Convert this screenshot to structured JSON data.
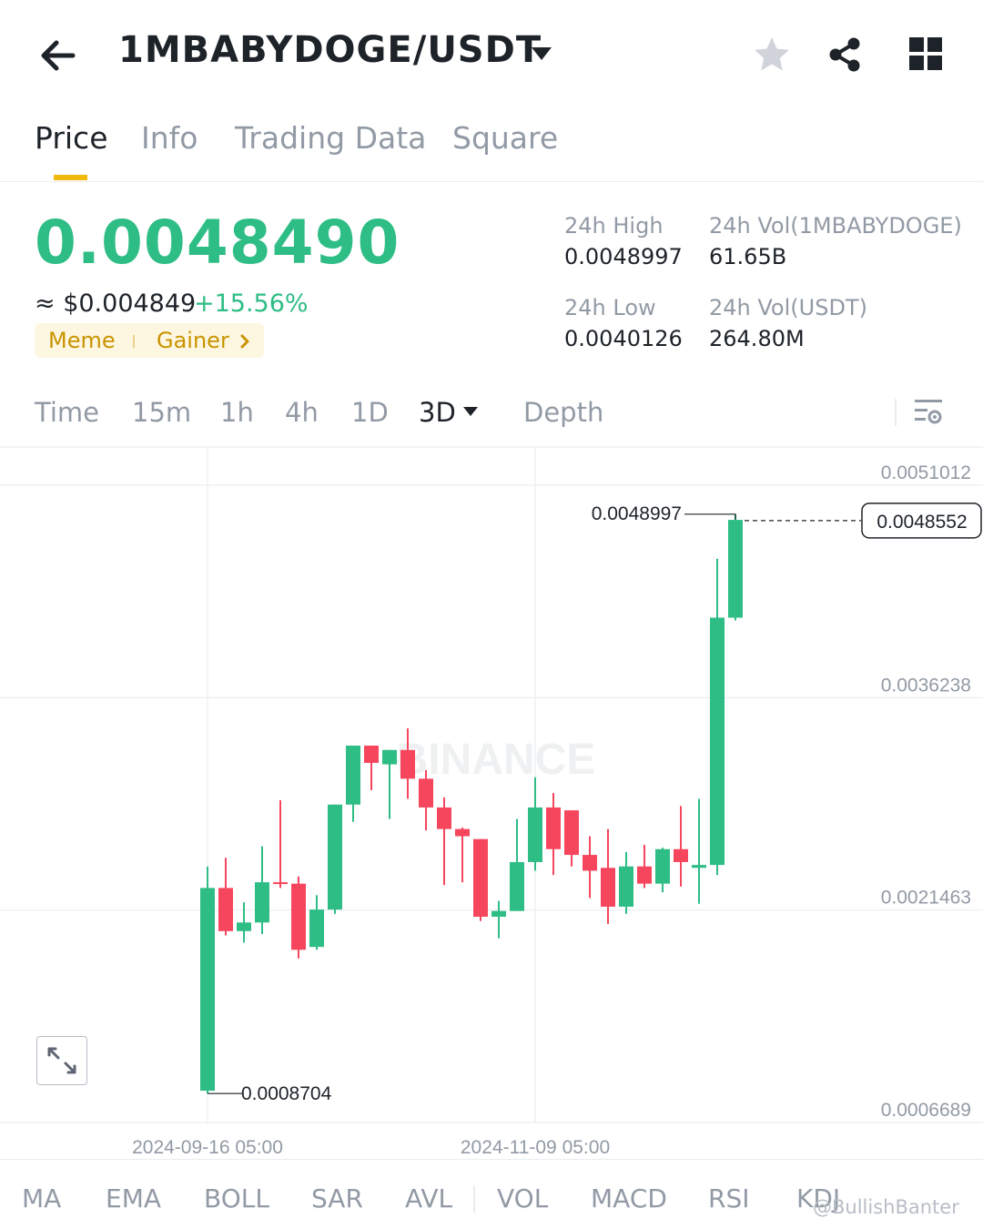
{
  "header": {
    "pair": "1MBABYDOGE/USDT",
    "icons": [
      "back-arrow-icon",
      "caret-down-icon",
      "star-icon",
      "share-icon",
      "grid-icon"
    ]
  },
  "tabs": [
    "Price",
    "Info",
    "Trading Data",
    "Square"
  ],
  "active_tab": "Price",
  "price": {
    "last": "0.0048490",
    "usd": "≈ $0.004849",
    "change": "+15.56%",
    "tags": [
      "Meme",
      "Gainer"
    ]
  },
  "stats": {
    "high_label": "24h High",
    "high_value": "0.0048997",
    "low_label": "24h Low",
    "low_value": "0.0040126",
    "vol_base_label": "24h Vol(1MBABYDOGE)",
    "vol_base_value": "61.65B",
    "vol_quote_label": "24h Vol(USDT)",
    "vol_quote_value": "264.80M"
  },
  "intervals": [
    "Time",
    "15m",
    "1h",
    "4h",
    "1D",
    "3D",
    "Depth"
  ],
  "active_interval": "3D",
  "indicators": [
    "MA",
    "EMA",
    "BOLL",
    "SAR",
    "AVL",
    "VOL",
    "MACD",
    "RSI",
    "KDJ"
  ],
  "watermark": {
    "chart": "BINANCE",
    "handle": "@BullishBanter"
  },
  "colors": {
    "up": "#2ebd85",
    "down": "#f6465d",
    "accent": "#f0b90b",
    "muted": "#929aa5",
    "text": "#1e2329"
  },
  "chart_data": {
    "type": "candlestick",
    "interval": "3D",
    "y_ticks": [
      "0.0051012",
      "0.0036238",
      "0.0021463",
      "0.0006689"
    ],
    "ylim": [
      0.0006689,
      0.0051012
    ],
    "x_ticks": [
      "2024-09-16 05:00",
      "2024-11-09 05:00"
    ],
    "annotations": {
      "max_label": "0.0048997",
      "min_label": "0.0008704",
      "current_price_label": "0.0048552"
    },
    "candles": [
      {
        "o": 0.00089,
        "h": 0.00245,
        "l": 0.00087,
        "c": 0.0023
      },
      {
        "o": 0.0023,
        "h": 0.00251,
        "l": 0.00197,
        "c": 0.002
      },
      {
        "o": 0.002,
        "h": 0.0022,
        "l": 0.00192,
        "c": 0.00206
      },
      {
        "o": 0.00206,
        "h": 0.00259,
        "l": 0.00198,
        "c": 0.00234
      },
      {
        "o": 0.00234,
        "h": 0.00291,
        "l": 0.0023,
        "c": 0.00233
      },
      {
        "o": 0.00233,
        "h": 0.00238,
        "l": 0.00181,
        "c": 0.00187
      },
      {
        "o": 0.00189,
        "h": 0.00225,
        "l": 0.00187,
        "c": 0.00215
      },
      {
        "o": 0.00215,
        "h": 0.00288,
        "l": 0.00212,
        "c": 0.00288
      },
      {
        "o": 0.00288,
        "h": 0.00324,
        "l": 0.00276,
        "c": 0.00329
      },
      {
        "o": 0.00329,
        "h": 0.00329,
        "l": 0.00298,
        "c": 0.00317
      },
      {
        "o": 0.00316,
        "h": 0.00313,
        "l": 0.00278,
        "c": 0.00326
      },
      {
        "o": 0.00326,
        "h": 0.00341,
        "l": 0.00292,
        "c": 0.00306
      },
      {
        "o": 0.00306,
        "h": 0.00312,
        "l": 0.0027,
        "c": 0.00286
      },
      {
        "o": 0.00286,
        "h": 0.00293,
        "l": 0.00232,
        "c": 0.00271
      },
      {
        "o": 0.00271,
        "h": 0.00272,
        "l": 0.00234,
        "c": 0.00266
      },
      {
        "o": 0.00264,
        "h": 0.00264,
        "l": 0.00207,
        "c": 0.0021
      },
      {
        "o": 0.0021,
        "h": 0.00221,
        "l": 0.00195,
        "c": 0.00214
      },
      {
        "o": 0.00214,
        "h": 0.00278,
        "l": 0.00214,
        "c": 0.00248
      },
      {
        "o": 0.00248,
        "h": 0.00307,
        "l": 0.00242,
        "c": 0.00286
      },
      {
        "o": 0.00286,
        "h": 0.00296,
        "l": 0.00239,
        "c": 0.00257
      },
      {
        "o": 0.00284,
        "h": 0.00283,
        "l": 0.00245,
        "c": 0.00253
      },
      {
        "o": 0.00253,
        "h": 0.00266,
        "l": 0.00223,
        "c": 0.00242
      },
      {
        "o": 0.00244,
        "h": 0.00271,
        "l": 0.00205,
        "c": 0.00217
      },
      {
        "o": 0.00217,
        "h": 0.00255,
        "l": 0.00212,
        "c": 0.00245
      },
      {
        "o": 0.00245,
        "h": 0.0026,
        "l": 0.0023,
        "c": 0.00233
      },
      {
        "o": 0.00233,
        "h": 0.00258,
        "l": 0.00227,
        "c": 0.00257
      },
      {
        "o": 0.00257,
        "h": 0.00287,
        "l": 0.00231,
        "c": 0.00248
      },
      {
        "o": 0.00244,
        "h": 0.00292,
        "l": 0.00219,
        "c": 0.00246
      },
      {
        "o": 0.00246,
        "h": 0.00459,
        "l": 0.00239,
        "c": 0.00418
      },
      {
        "o": 0.00418,
        "h": 0.0049,
        "l": 0.00416,
        "c": 0.00486
      }
    ]
  }
}
